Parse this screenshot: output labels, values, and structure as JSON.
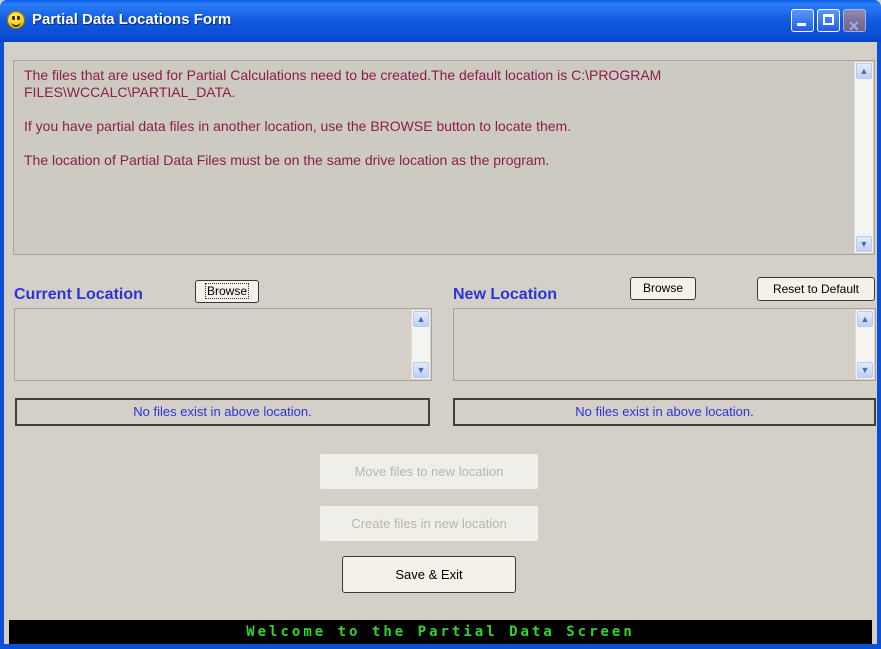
{
  "window": {
    "title": "Partial Data Locations Form",
    "icon": "smiley-icon"
  },
  "info": {
    "lines": [
      "The files that are used for Partial Calculations need to be created.The default location is C:\\PROGRAM FILES\\WCCALC\\PARTIAL_DATA.",
      "If you have partial data files in another location, use the BROWSE button to locate them.",
      "The location of Partial Data Files must be on the same drive location as the program."
    ]
  },
  "current": {
    "label": "Current Location",
    "browse_label": "Browse",
    "status": "No files exist in above location."
  },
  "new": {
    "label": "New Location",
    "browse_label": "Browse",
    "reset_label": "Reset to Default",
    "status": "No files exist in above location."
  },
  "actions": {
    "move_label": "Move files to new location",
    "create_label": "Create files in new location",
    "save_label": "Save & Exit"
  },
  "footer": {
    "text": "Welcome to the Partial Data Screen"
  },
  "colors": {
    "info_text": "#8b1e4a",
    "label_blue": "#2a35d8",
    "footer_green": "#2fd42f",
    "titlebar_blue": "#0a4fd6"
  }
}
